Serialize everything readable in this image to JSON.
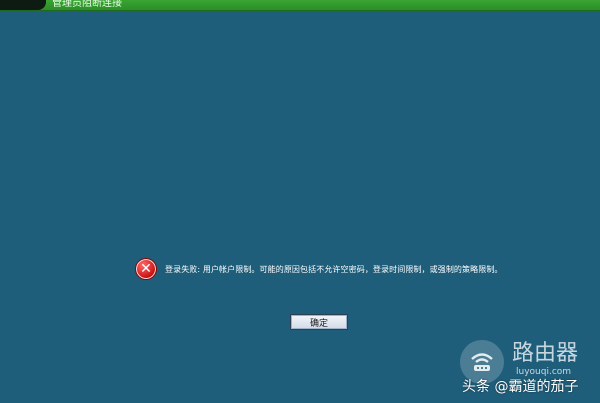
{
  "window": {
    "title": "管理员阻断连接"
  },
  "dialog": {
    "error_message": "登录失败: 用户帐户限制。可能的原因包括不允许空密码，登录时间限制，或强制的策略限制。",
    "ok_label": "确定",
    "icon": "error-x-icon"
  },
  "watermark": {
    "title": "路由器",
    "domain": "luyouqi.com",
    "author": "头条 @霸道的茄子"
  },
  "colors": {
    "background": "#1f5e7b",
    "titlebar": "#2b8e28",
    "error_icon": "#c60f0f"
  }
}
